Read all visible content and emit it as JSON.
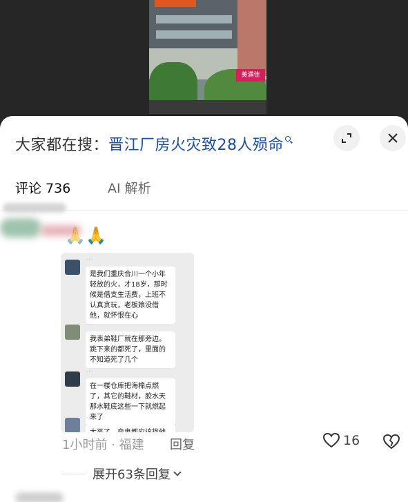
{
  "video": {
    "sign_text": "美满佳"
  },
  "header": {
    "search_prefix": "大家都在搜：",
    "search_term": "晋江厂房火灾致28人殒命",
    "icons": [
      "search-icon",
      "expand-icon",
      "close-icon"
    ]
  },
  "tabs": [
    {
      "label": "评论 736",
      "active": true
    },
    {
      "label": "AI 解析",
      "active": false
    }
  ],
  "comment": {
    "reaction_emojis": [
      "🙏",
      "🙏"
    ],
    "screenshot_messages": [
      {
        "text": "是我们重庆合川一个小年轻放的火，才18岁，那时候是借支生活费，上班不认真贪玩，老板娘没借他，就怀恨在心"
      },
      {
        "text": "我表弟鞋厂就在那旁边。跳下来的都死了，里面的不知道死了几个"
      },
      {
        "text": "在一楼仓库把海棉点燃了，其它的鞋材，胶水天那水鞋底这些一下就燃起来了"
      },
      {
        "text": "太恶了，变鬼都应该找他"
      }
    ],
    "meta": "1小时前 · 福建",
    "reply_label": "回复",
    "like_count": "16",
    "expand_replies_label": "展开63条回复"
  },
  "colors": {
    "search_term": "#1e4ea1",
    "sheet_background": "#ffffff",
    "backdrop": "#262626"
  }
}
